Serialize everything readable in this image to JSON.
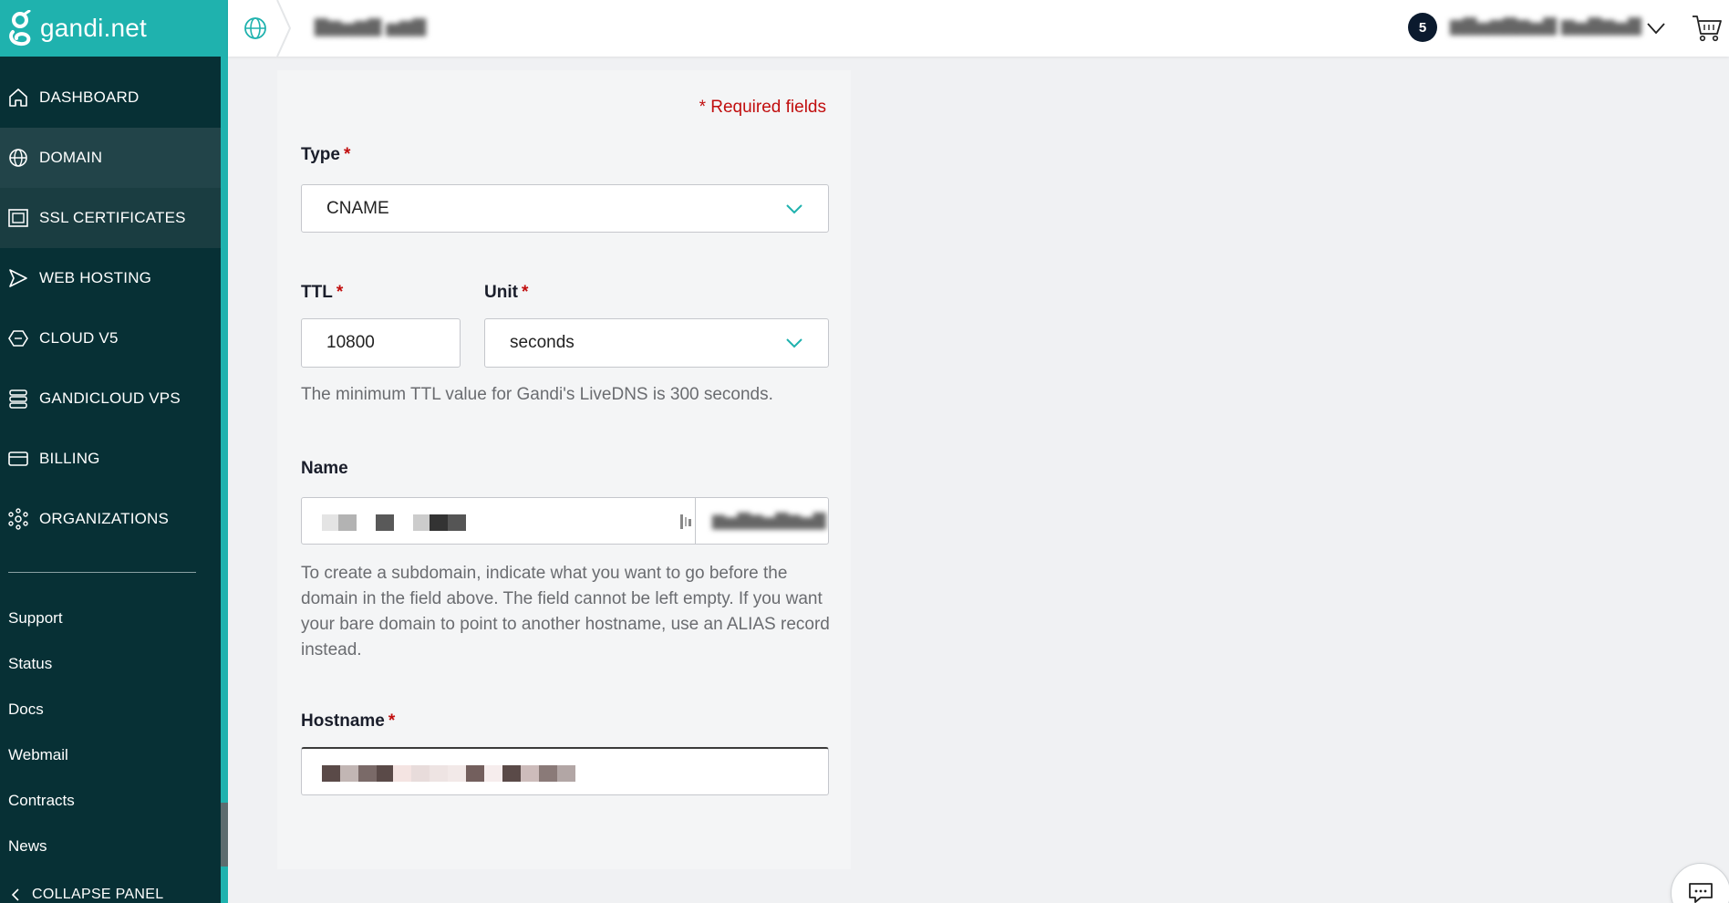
{
  "brand": {
    "name": "gandi.net",
    "accent_color": "#1fb2ae",
    "sidebar_color": "#073035"
  },
  "sidebar": {
    "items": [
      {
        "label": "DASHBOARD",
        "icon": "home-icon"
      },
      {
        "label": "DOMAIN",
        "icon": "globe-icon",
        "active": true
      },
      {
        "label": "SSL CERTIFICATES",
        "icon": "certificate-icon"
      },
      {
        "label": "WEB HOSTING",
        "icon": "send-icon"
      },
      {
        "label": "CLOUD V5",
        "icon": "cloud-hexagon-icon"
      },
      {
        "label": "GANDICLOUD VPS",
        "icon": "server-stack-icon"
      },
      {
        "label": "BILLING",
        "icon": "credit-card-icon"
      },
      {
        "label": "ORGANIZATIONS",
        "icon": "organization-icon"
      }
    ],
    "links": [
      "Support",
      "Status",
      "Docs",
      "Webmail",
      "Contracts",
      "News"
    ],
    "collapse_label": "COLLAPSE PANEL"
  },
  "topbar": {
    "notification_count": "5"
  },
  "form": {
    "required_note": "* Required fields",
    "type_label": "Type",
    "type_value": "CNAME",
    "ttl_label": "TTL",
    "ttl_value": "10800",
    "unit_label": "Unit",
    "unit_value": "seconds",
    "ttl_help": "The minimum TTL value for Gandi's LiveDNS is 300 seconds.",
    "name_label": "Name",
    "name_help": "To create a subdomain, indicate what you want to go before the domain in the field above. The field cannot be left empty. If you want your bare domain to point to another hostname, use an ALIAS record instead.",
    "hostname_label": "Hostname",
    "required_marker": "*"
  }
}
